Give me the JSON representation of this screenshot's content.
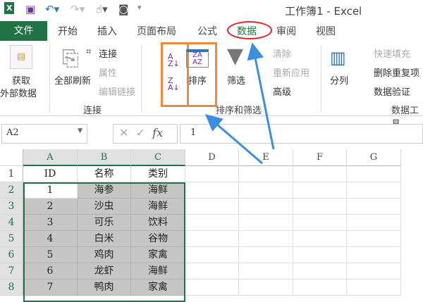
{
  "title": "工作簿1 - Excel",
  "tabs": {
    "file": "文件",
    "items": [
      "开始",
      "插入",
      "页面布局",
      "公式",
      "数据",
      "审阅",
      "视图"
    ]
  },
  "ribbon": {
    "get_external": [
      "获取",
      "外部数据"
    ],
    "refresh_all": "全部刷新",
    "connections": "连接",
    "properties": "属性",
    "edit_links": "编辑链接",
    "group_connections": "连接",
    "sort": "排序",
    "filter": "筛选",
    "clear": "清除",
    "reapply": "重新应用",
    "advanced": "高级",
    "group_sort_filter": "排序和筛选",
    "text_to_columns": "分列",
    "flash_fill": "快速填充",
    "remove_duplicates": "删除重复项",
    "data_validation": "数据验证",
    "group_data_tools": "数据工具"
  },
  "formula_bar": {
    "name_box": "A2",
    "fx": "fx",
    "value": "1"
  },
  "sheet": {
    "columns": [
      "A",
      "B",
      "C",
      "D",
      "E",
      "F",
      "G"
    ],
    "rows": [
      "1",
      "2",
      "3",
      "4",
      "5",
      "6",
      "7",
      "8"
    ],
    "data": [
      [
        "ID",
        "名称",
        "类别"
      ],
      [
        "1",
        "海参",
        "海鲜"
      ],
      [
        "2",
        "沙虫",
        "海鲜"
      ],
      [
        "3",
        "可乐",
        "饮料"
      ],
      [
        "4",
        "白米",
        "谷物"
      ],
      [
        "5",
        "鸡肉",
        "家禽"
      ],
      [
        "6",
        "龙虾",
        "海鲜"
      ],
      [
        "7",
        "鸭肉",
        "家禽"
      ]
    ]
  },
  "colors": {
    "accent": "#217346",
    "highlight": "#e8231f",
    "box": "#f0883a",
    "arrow": "#3a8fe0"
  }
}
